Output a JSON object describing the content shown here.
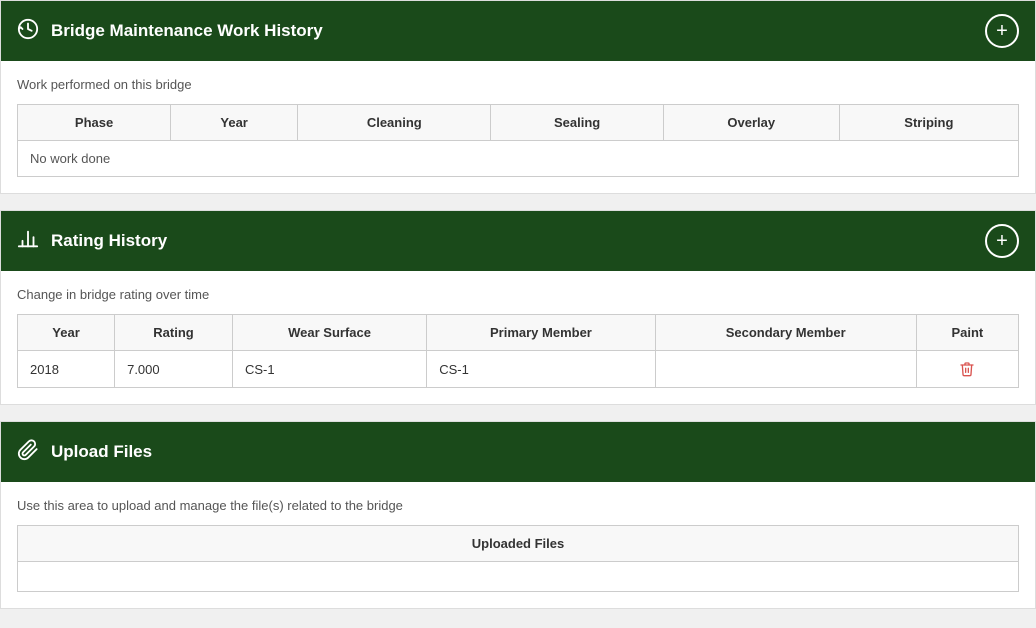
{
  "sections": {
    "work_history": {
      "title": "Bridge Maintenance Work History",
      "icon": "history-icon",
      "description": "Work performed on this bridge",
      "add_button_label": "+",
      "table": {
        "columns": [
          "Phase",
          "Year",
          "Cleaning",
          "Sealing",
          "Overlay",
          "Striping"
        ],
        "rows": [],
        "empty_message": "No work done"
      }
    },
    "rating_history": {
      "title": "Rating History",
      "icon": "chart-icon",
      "description": "Change in bridge rating over time",
      "add_button_label": "+",
      "table": {
        "columns": [
          "Year",
          "Rating",
          "Wear Surface",
          "Primary Member",
          "Secondary Member",
          "Paint"
        ],
        "rows": [
          {
            "year": "2018",
            "rating": "7.000",
            "wear_surface": "CS-1",
            "primary_member": "CS-1",
            "secondary_member": "",
            "paint": ""
          }
        ]
      }
    },
    "upload_files": {
      "title": "Upload Files",
      "icon": "paperclip-icon",
      "description": "Use this area to upload and manage the file(s) related to the bridge",
      "table": {
        "columns": [
          "Uploaded Files"
        ]
      }
    }
  }
}
